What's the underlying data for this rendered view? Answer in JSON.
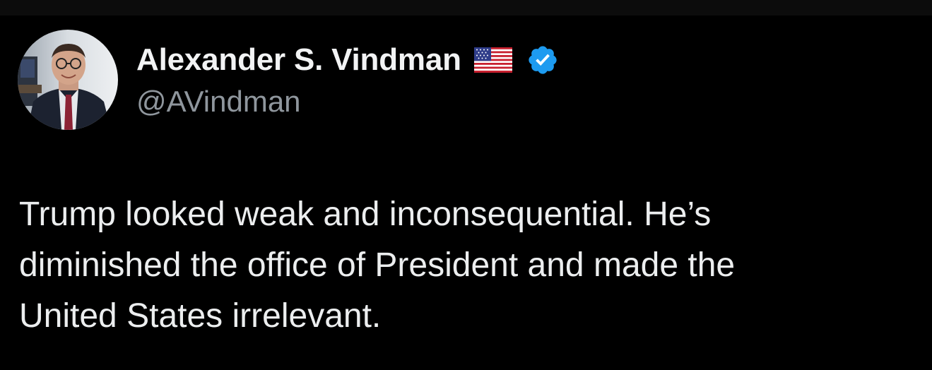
{
  "author": {
    "display_name": "Alexander S. Vindman",
    "handle": "@AVindman",
    "flag_icon": "us-flag-icon",
    "verified_icon": "verified-badge-icon",
    "verified_color": "#1d9bf0"
  },
  "tweet": {
    "lines": [
      "Trump looked weak and inconsequential. He’s",
      "diminished the office of President and made the",
      "United States irrelevant."
    ]
  },
  "colors": {
    "background": "#000000",
    "text_primary": "#e7e9ea",
    "text_secondary": "#8f969d"
  }
}
